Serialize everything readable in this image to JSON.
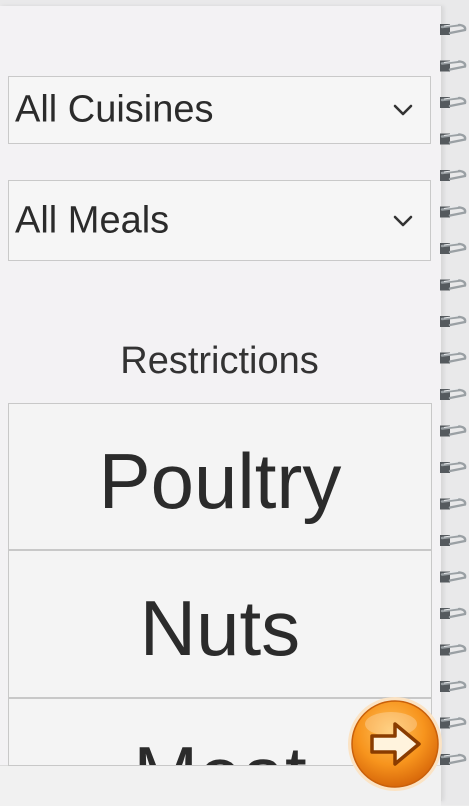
{
  "filters": {
    "cuisine": {
      "selected": "All Cuisines",
      "icon": "chevron-down-icon"
    },
    "meal": {
      "selected": "All Meals",
      "icon": "chevron-down-icon"
    }
  },
  "restrictions": {
    "title": "Restrictions",
    "items": [
      {
        "label": "Poultry"
      },
      {
        "label": "Nuts"
      },
      {
        "label": "Meat"
      }
    ]
  },
  "next_button": {
    "icon": "arrow-right-icon",
    "color": "#f7941d"
  },
  "colors": {
    "paper": "#f3f2f4",
    "text": "#2b2b2b",
    "accent": "#f7941d"
  }
}
